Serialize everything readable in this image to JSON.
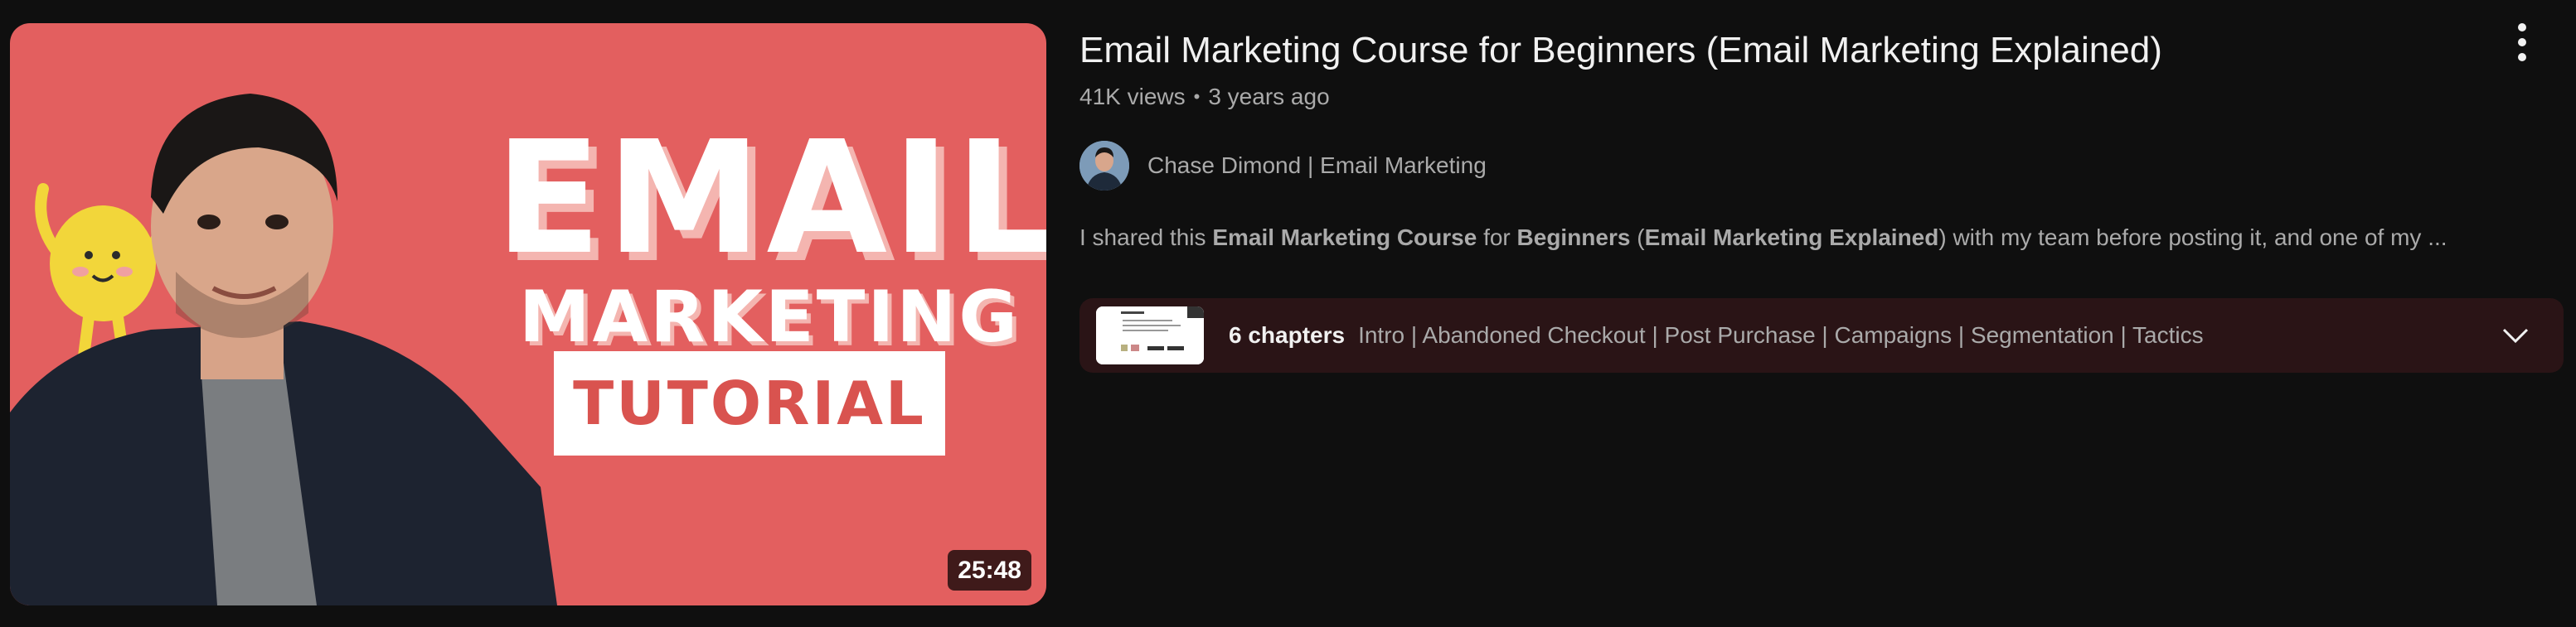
{
  "video": {
    "duration": "25:48",
    "thumbnail_text": {
      "line1": "EMAIL",
      "line2": "MARKETING",
      "line3": "TUTORIAL"
    },
    "title": "Email Marketing Course for Beginners (Email Marketing Explained)",
    "views": "41K views",
    "separator": "•",
    "age": "3 years ago",
    "channel": "Chase Dimond | Email Marketing",
    "description": {
      "parts": [
        "I shared this ",
        "Email Marketing Course",
        " for ",
        "Beginners",
        " (",
        "Email Marketing Explained",
        ") with my team before posting it, and one of my ..."
      ]
    },
    "chapters": {
      "count_label": "6 chapters",
      "list": "Intro | Abandoned Checkout | Post Purchase | Campaigns | Segmentation | Tactics"
    }
  },
  "icons": {
    "more": "more-vert-icon",
    "expand": "chevron-down-icon"
  },
  "colors": {
    "background": "#0f0f0f",
    "thumbnail_bg": "#e35f5f",
    "chapters_bg": "#2a1416",
    "text_primary": "#f1f1f1",
    "text_secondary": "#aaaaaa"
  }
}
